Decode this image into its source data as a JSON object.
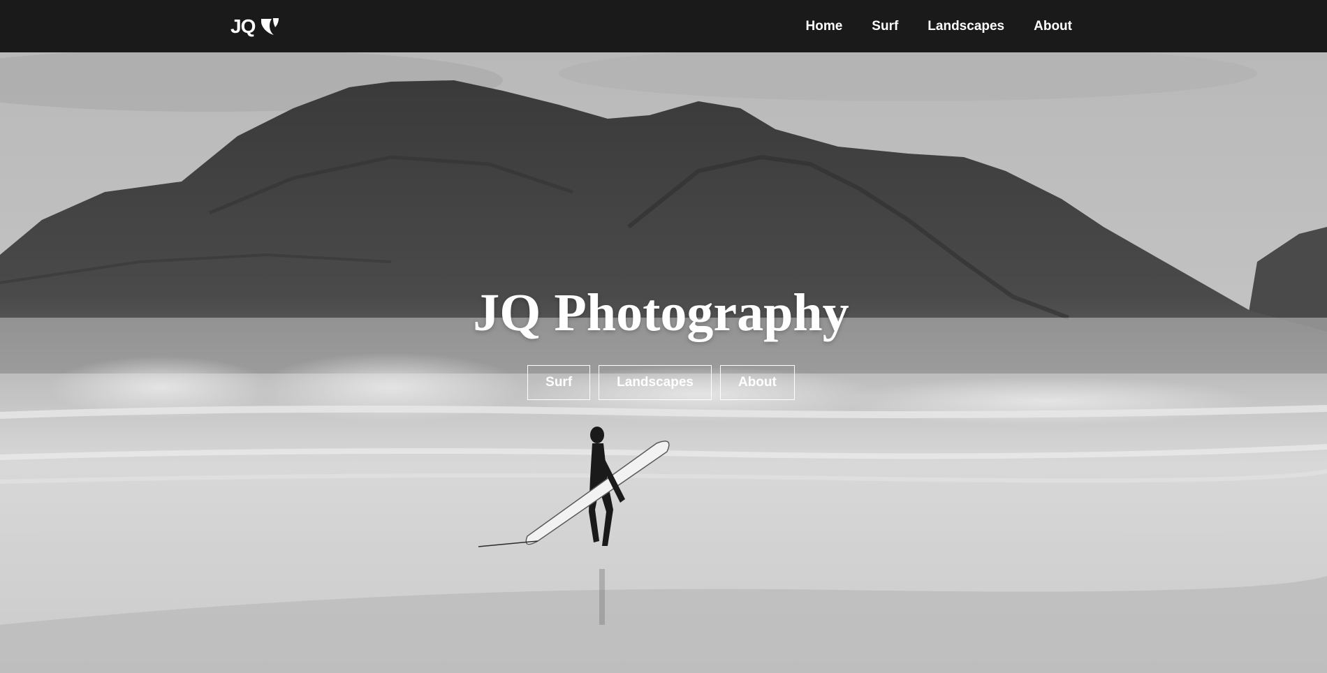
{
  "brand": {
    "logo_text": "JQ",
    "logo_icon": "typo3-shield-icon"
  },
  "nav": {
    "items": [
      {
        "label": "Home"
      },
      {
        "label": "Surf"
      },
      {
        "label": "Landscapes"
      },
      {
        "label": "About"
      }
    ]
  },
  "hero": {
    "title": "JQ Photography",
    "buttons": [
      {
        "label": "Surf"
      },
      {
        "label": "Landscapes"
      },
      {
        "label": "About"
      }
    ],
    "image": "surfer-on-beach-with-mountain-photo"
  },
  "colors": {
    "navbar_bg": "#1b1a1b",
    "text": "#ffffff"
  }
}
